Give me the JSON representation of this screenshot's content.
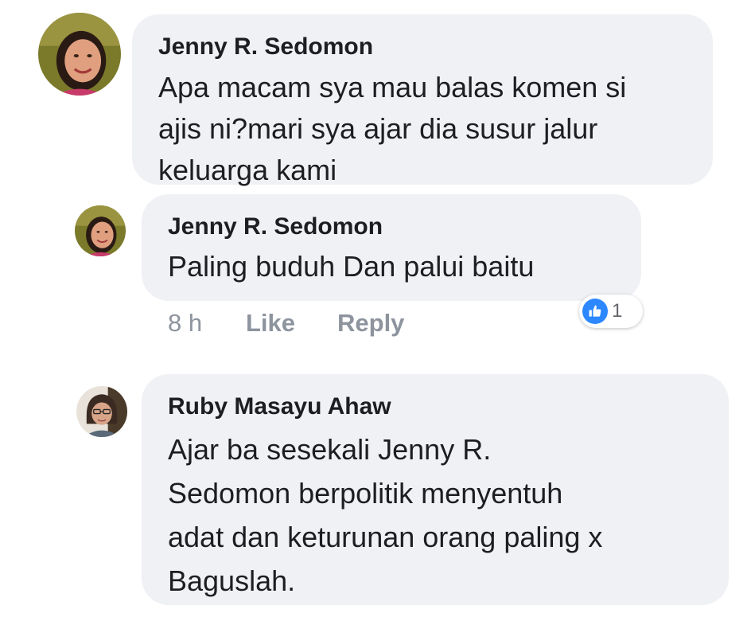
{
  "comments": [
    {
      "author": "Jenny R. Sedomon",
      "avatar_icon": "profile-photo-woman-smiling",
      "lines": [
        "Apa macam sya mau balas komen si",
        "ajis ni?mari sya ajar dia susur jalur",
        "keluarga kami"
      ]
    },
    {
      "author": "Jenny R. Sedomon",
      "avatar_icon": "profile-photo-woman-smiling",
      "lines": [
        "Paling buduh Dan palui baitu"
      ],
      "meta": {
        "time": "8 h",
        "like_label": "Like",
        "reply_label": "Reply"
      },
      "reaction": {
        "icon": "thumbs-up-icon",
        "count": "1",
        "color": "#2d88ff"
      }
    },
    {
      "author": "Ruby Masayu Ahaw",
      "avatar_icon": "profile-photo-woman-glasses",
      "lines": [
        "Ajar ba sesekali Jenny R.",
        "Sedomon berpolitik menyentuh",
        "adat dan keturunan orang paling x",
        "Baguslah."
      ]
    }
  ],
  "colors": {
    "bubble_bg": "#f0f1f4",
    "text": "#1c1e21",
    "meta_text": "#8d949e"
  }
}
